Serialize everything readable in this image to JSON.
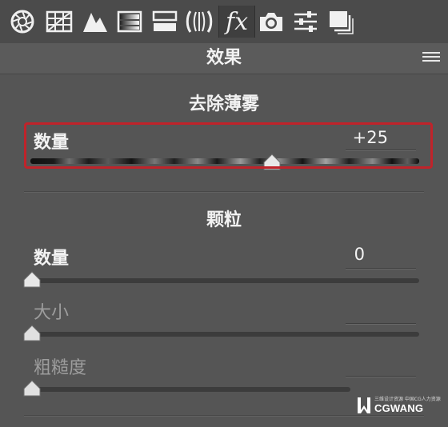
{
  "toolbar": {
    "tools": [
      {
        "icon": "aperture-icon"
      },
      {
        "icon": "grid-icon"
      },
      {
        "icon": "mountain-icon"
      },
      {
        "icon": "gradient-icon"
      },
      {
        "icon": "split-toning-icon"
      },
      {
        "icon": "lens-icon"
      },
      {
        "icon": "fx-icon",
        "label": "fx",
        "active": true
      },
      {
        "icon": "camera-icon"
      },
      {
        "icon": "sliders-icon"
      },
      {
        "icon": "presets-icon"
      }
    ]
  },
  "header": {
    "title": "效果",
    "menu_icon": "menu-icon"
  },
  "dehaze": {
    "section_title": "去除薄雾",
    "amount_label": "数量",
    "amount_value": "+25",
    "amount_position": 0.5,
    "highlight_color": "#c0232a"
  },
  "grain": {
    "section_title": "颗粒",
    "amount_label": "数量",
    "amount_value": "0",
    "size_label": "大小",
    "roughness_label": "粗糙度"
  },
  "watermark": {
    "small_text": "三维设计资源 中国CG人力资源",
    "brand": "CGWANG"
  }
}
